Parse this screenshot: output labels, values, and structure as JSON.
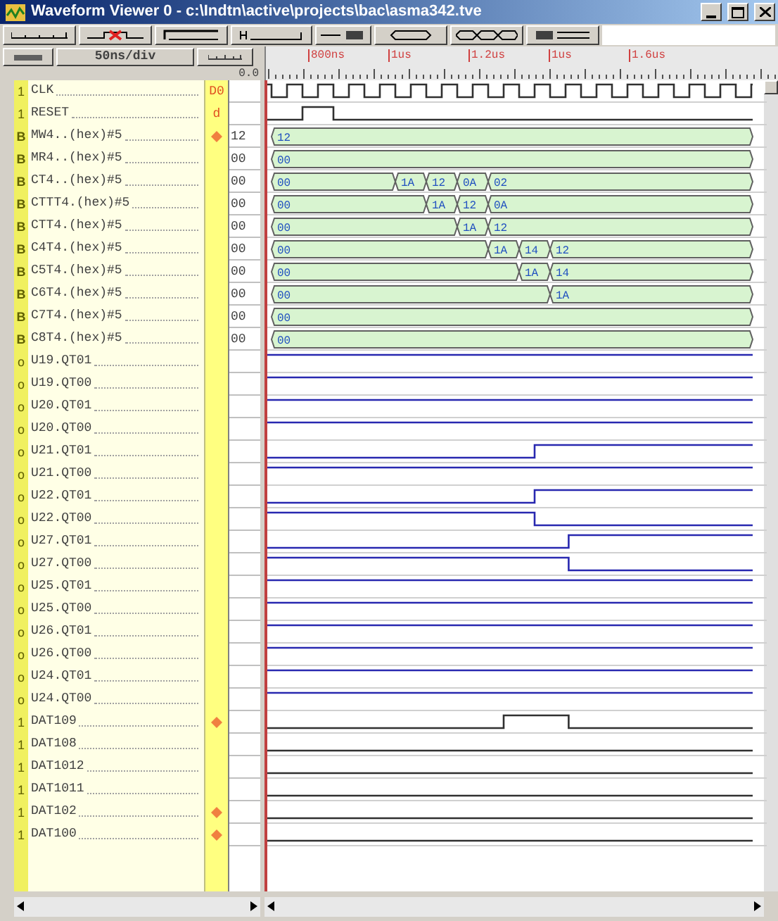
{
  "window": {
    "title": "Waveform Viewer 0  -  c:\\Indtn\\active\\projects\\bac\\asma342.tve"
  },
  "toolbar": {
    "zoom": "50ns/div",
    "cursor_time": "0.0"
  },
  "ruler": {
    "labels": [
      "800ns",
      "1us",
      "1.2us",
      "1us",
      "1.6us"
    ]
  },
  "signals": [
    {
      "type": "1",
      "name": "CLK",
      "marker_text": "D0",
      "kind": "clock"
    },
    {
      "type": "1",
      "name": "RESET",
      "marker_text": "d",
      "kind": "bit"
    },
    {
      "type": "B",
      "name": "MW4..(hex)#5",
      "marker": true,
      "value": "12",
      "kind": "bus",
      "segments": [
        "12"
      ]
    },
    {
      "type": "B",
      "name": "MR4..(hex)#5",
      "value": "00",
      "kind": "bus",
      "segments": [
        "00"
      ]
    },
    {
      "type": "B",
      "name": "CT4..(hex)#5",
      "value": "00",
      "kind": "bus",
      "segments": [
        "00",
        "1A",
        "12",
        "0A",
        "02"
      ]
    },
    {
      "type": "B",
      "name": "CTTT4.(hex)#5",
      "value": "00",
      "kind": "bus",
      "segments": [
        "00",
        "1A",
        "12",
        "0A"
      ]
    },
    {
      "type": "B",
      "name": "CTT4.(hex)#5",
      "value": "00",
      "kind": "bus",
      "segments": [
        "00",
        "1A",
        "12"
      ]
    },
    {
      "type": "B",
      "name": "C4T4.(hex)#5",
      "value": "00",
      "kind": "bus",
      "segments": [
        "00",
        "1A",
        "14",
        "12"
      ]
    },
    {
      "type": "B",
      "name": "C5T4.(hex)#5",
      "value": "00",
      "kind": "bus",
      "segments": [
        "00",
        "1A",
        "14"
      ]
    },
    {
      "type": "B",
      "name": "C6T4.(hex)#5",
      "value": "00",
      "kind": "bus",
      "segments": [
        "00",
        "1A"
      ]
    },
    {
      "type": "B",
      "name": "C7T4.(hex)#5",
      "value": "00",
      "kind": "bus",
      "segments": [
        "00"
      ]
    },
    {
      "type": "B",
      "name": "C8T4.(hex)#5",
      "value": "00",
      "kind": "bus",
      "segments": [
        "00"
      ]
    },
    {
      "type": "o",
      "name": "U19.QT01",
      "kind": "bit"
    },
    {
      "type": "o",
      "name": "U19.QT00",
      "kind": "bit"
    },
    {
      "type": "o",
      "name": "U20.QT01",
      "kind": "bit"
    },
    {
      "type": "o",
      "name": "U20.QT00",
      "kind": "bit"
    },
    {
      "type": "o",
      "name": "U21.QT01",
      "kind": "bit"
    },
    {
      "type": "o",
      "name": "U21.QT00",
      "kind": "bit"
    },
    {
      "type": "o",
      "name": "U22.QT01",
      "kind": "bit"
    },
    {
      "type": "o",
      "name": "U22.QT00",
      "kind": "bit"
    },
    {
      "type": "o",
      "name": "U27.QT01",
      "kind": "bit"
    },
    {
      "type": "o",
      "name": "U27.QT00",
      "kind": "bit"
    },
    {
      "type": "o",
      "name": "U25.QT01",
      "kind": "bit"
    },
    {
      "type": "o",
      "name": "U25.QT00",
      "kind": "bit"
    },
    {
      "type": "o",
      "name": "U26.QT01",
      "kind": "bit"
    },
    {
      "type": "o",
      "name": "U26.QT00",
      "kind": "bit"
    },
    {
      "type": "o",
      "name": "U24.QT01",
      "kind": "bit"
    },
    {
      "type": "o",
      "name": "U24.QT00",
      "kind": "bit"
    },
    {
      "type": "1",
      "name": "DAT109",
      "marker": true,
      "kind": "bit"
    },
    {
      "type": "1",
      "name": "DAT108",
      "kind": "bit"
    },
    {
      "type": "1",
      "name": "DAT1012",
      "kind": "bit"
    },
    {
      "type": "1",
      "name": "DAT1011",
      "kind": "bit"
    },
    {
      "type": "1",
      "name": "DAT102",
      "marker": true,
      "kind": "bit"
    },
    {
      "type": "1",
      "name": "DAT100",
      "marker": true,
      "kind": "bit"
    }
  ]
}
